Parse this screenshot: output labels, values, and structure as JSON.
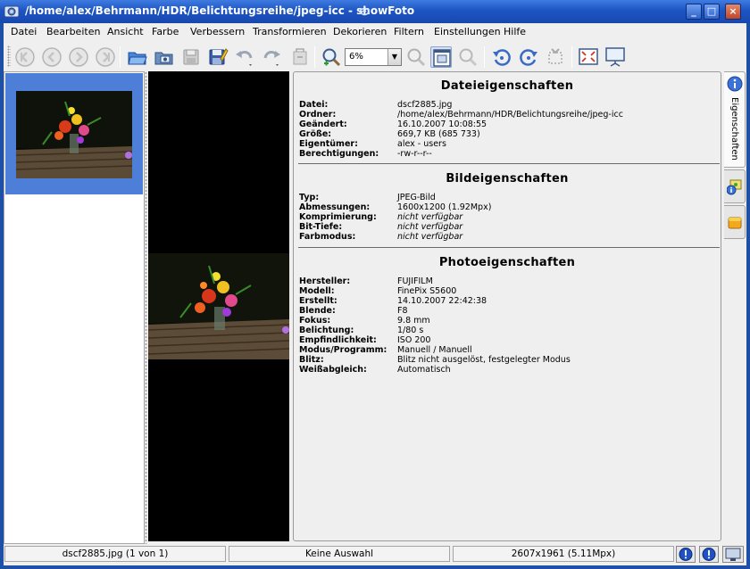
{
  "window": {
    "title": "/home/alex/Behrmann/HDR/Belichtungsreihe/jpeg-icc - showFoto",
    "controls": [
      "minimize",
      "maximize",
      "close"
    ]
  },
  "menu": [
    "Datei",
    "Bearbeiten",
    "Ansicht",
    "Farbe",
    "Verbessern",
    "Transformieren",
    "Dekorieren",
    "Filtern",
    "Einstellungen",
    "Hilfe"
  ],
  "toolbar": {
    "zoom_value": "6%",
    "icons": [
      "first-icon",
      "back-icon",
      "forward-icon",
      "last-icon",
      "open-folder-icon",
      "open-album-icon",
      "save-icon",
      "save-as-icon",
      "undo-icon",
      "redo-icon",
      "revert-icon",
      "zoom-in-icon",
      "zoom-out-icon",
      "fit-window-icon",
      "zoom-selection-icon",
      "rotate-left-icon",
      "rotate-right-icon",
      "crop-icon",
      "fullscreen-icon",
      "slideshow-icon"
    ]
  },
  "properties": {
    "file": {
      "title": "Dateieigenschaften",
      "rows": [
        {
          "key": "Datei:",
          "value": "dscf2885.jpg"
        },
        {
          "key": "Ordner:",
          "value": "/home/alex/Behrmann/HDR/Belichtungsreihe/jpeg-icc"
        },
        {
          "key": "Geändert:",
          "value": "16.10.2007 10:08:55"
        },
        {
          "key": "Größe:",
          "value": "669,7 KB (685 733)"
        },
        {
          "key": "Eigentümer:",
          "value": "alex - users"
        },
        {
          "key": "Berechtigungen:",
          "value": "-rw-r--r--"
        }
      ]
    },
    "image": {
      "title": "Bildeigenschaften",
      "rows": [
        {
          "key": "Typ:",
          "value": "JPEG-Bild",
          "italic": false
        },
        {
          "key": "Abmessungen:",
          "value": "1600x1200 (1.92Mpx)",
          "italic": false
        },
        {
          "key": "Komprimierung:",
          "value": "nicht verfügbar",
          "italic": true
        },
        {
          "key": "Bit-Tiefe:",
          "value": "nicht verfügbar",
          "italic": true
        },
        {
          "key": "Farbmodus:",
          "value": "nicht verfügbar",
          "italic": true
        }
      ]
    },
    "photo": {
      "title": "Photoeigenschaften",
      "rows": [
        {
          "key": "Hersteller:",
          "value": "FUJIFILM"
        },
        {
          "key": "Modell:",
          "value": "FinePix S5600"
        },
        {
          "key": "Erstellt:",
          "value": "14.10.2007 22:42:38"
        },
        {
          "key": "Blende:",
          "value": "F8"
        },
        {
          "key": "Fokus:",
          "value": "9.8 mm"
        },
        {
          "key": "Belichtung:",
          "value": "1/80 s"
        },
        {
          "key": "Empfindlichkeit:",
          "value": "ISO 200"
        },
        {
          "key": "Modus/Programm:",
          "value": "Manuell / Manuell"
        },
        {
          "key": "Blitz:",
          "value": "Blitz nicht ausgelöst, festgelegter Modus"
        },
        {
          "key": "Weißabgleich:",
          "value": "Automatisch"
        }
      ]
    }
  },
  "sidebar": {
    "tabs": [
      {
        "label": "Eigenschaften",
        "icon": "info-icon"
      },
      {
        "label": "",
        "icon": "metadata-icon"
      },
      {
        "label": "",
        "icon": "colors-icon"
      }
    ]
  },
  "statusbar": {
    "file": "dscf2885.jpg (1 von 1)",
    "selection": "Keine Auswahl",
    "size": "2607x1961 (5.11Mpx)"
  },
  "colors": {
    "titlebar": "#1d55c4",
    "selection": "#4d7fd8",
    "canvas": "#000000"
  }
}
